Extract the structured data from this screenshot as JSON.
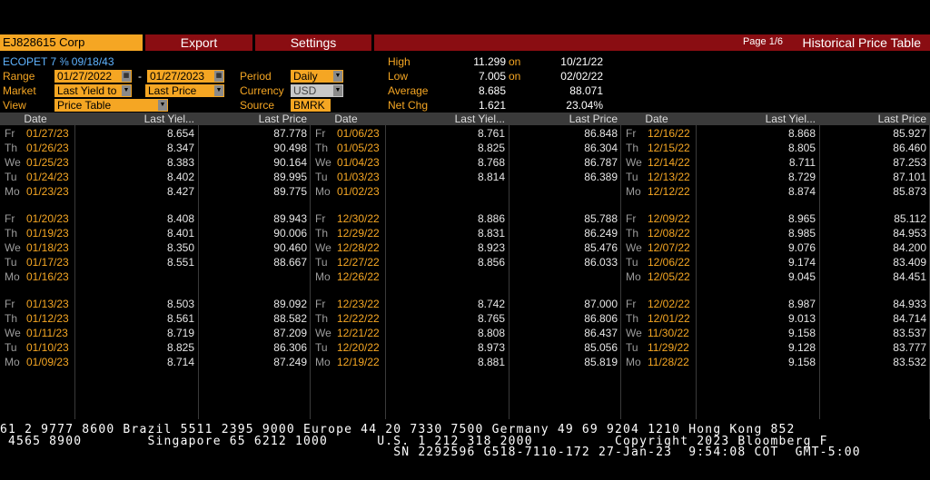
{
  "toolbar": {
    "security": "EJ828615 Corp",
    "export": "Export",
    "settings": "Settings",
    "page": "Page 1/6",
    "title": "Historical Price Table"
  },
  "bond": {
    "name": "ECOPET 7 ⅜ 09/18/43"
  },
  "controls": {
    "range_label": "Range",
    "range_start": "01/27/2022",
    "range_sep": "-",
    "range_end": "01/27/2023",
    "period_label": "Period",
    "period_value": "Daily",
    "market_label": "Market",
    "market_value1": "Last Yield to",
    "market_value2": "Last Price",
    "currency_label": "Currency",
    "currency_value": "USD",
    "view_label": "View",
    "view_value": "Price Table",
    "source_label": "Source",
    "source_value": "BMRK"
  },
  "stats": [
    {
      "label": "High",
      "value": "11.299",
      "on": "on",
      "date": "10/21/22"
    },
    {
      "label": "Low",
      "value": "7.005",
      "on": "on",
      "date": "02/02/22"
    },
    {
      "label": "Average",
      "value": "8.685",
      "on": "",
      "date": "88.071"
    },
    {
      "label": "Net Chg",
      "value": "1.621",
      "on": "",
      "date": "23.04%"
    }
  ],
  "columns": {
    "date": "Date",
    "yield": "Last Yiel...",
    "price": "Last Price"
  },
  "table": [
    [
      [
        "Fr",
        "01/27/23",
        "8.654",
        "87.778"
      ],
      [
        "Th",
        "01/26/23",
        "8.347",
        "90.498"
      ],
      [
        "We",
        "01/25/23",
        "8.383",
        "90.164"
      ],
      [
        "Tu",
        "01/24/23",
        "8.402",
        "89.995"
      ],
      [
        "Mo",
        "01/23/23",
        "8.427",
        "89.775"
      ],
      [
        "Fr",
        "01/20/23",
        "8.408",
        "89.943"
      ],
      [
        "Th",
        "01/19/23",
        "8.401",
        "90.006"
      ],
      [
        "We",
        "01/18/23",
        "8.350",
        "90.460"
      ],
      [
        "Tu",
        "01/17/23",
        "8.551",
        "88.667"
      ],
      [
        "Mo",
        "01/16/23",
        "",
        ""
      ],
      [
        "Fr",
        "01/13/23",
        "8.503",
        "89.092"
      ],
      [
        "Th",
        "01/12/23",
        "8.561",
        "88.582"
      ],
      [
        "We",
        "01/11/23",
        "8.719",
        "87.209"
      ],
      [
        "Tu",
        "01/10/23",
        "8.825",
        "86.306"
      ],
      [
        "Mo",
        "01/09/23",
        "8.714",
        "87.249"
      ]
    ],
    [
      [
        "Fr",
        "01/06/23",
        "8.761",
        "86.848"
      ],
      [
        "Th",
        "01/05/23",
        "8.825",
        "86.304"
      ],
      [
        "We",
        "01/04/23",
        "8.768",
        "86.787"
      ],
      [
        "Tu",
        "01/03/23",
        "8.814",
        "86.389"
      ],
      [
        "Mo",
        "01/02/23",
        "",
        ""
      ],
      [
        "Fr",
        "12/30/22",
        "8.886",
        "85.788"
      ],
      [
        "Th",
        "12/29/22",
        "8.831",
        "86.249"
      ],
      [
        "We",
        "12/28/22",
        "8.923",
        "85.476"
      ],
      [
        "Tu",
        "12/27/22",
        "8.856",
        "86.033"
      ],
      [
        "Mo",
        "12/26/22",
        "",
        ""
      ],
      [
        "Fr",
        "12/23/22",
        "8.742",
        "87.000"
      ],
      [
        "Th",
        "12/22/22",
        "8.765",
        "86.806"
      ],
      [
        "We",
        "12/21/22",
        "8.808",
        "86.437"
      ],
      [
        "Tu",
        "12/20/22",
        "8.973",
        "85.056"
      ],
      [
        "Mo",
        "12/19/22",
        "8.881",
        "85.819"
      ]
    ],
    [
      [
        "Fr",
        "12/16/22",
        "8.868",
        "85.927"
      ],
      [
        "Th",
        "12/15/22",
        "8.805",
        "86.460"
      ],
      [
        "We",
        "12/14/22",
        "8.711",
        "87.253"
      ],
      [
        "Tu",
        "12/13/22",
        "8.729",
        "87.101"
      ],
      [
        "Mo",
        "12/12/22",
        "8.874",
        "85.873"
      ],
      [
        "Fr",
        "12/09/22",
        "8.965",
        "85.112"
      ],
      [
        "Th",
        "12/08/22",
        "8.985",
        "84.953"
      ],
      [
        "We",
        "12/07/22",
        "9.076",
        "84.200"
      ],
      [
        "Tu",
        "12/06/22",
        "9.174",
        "83.409"
      ],
      [
        "Mo",
        "12/05/22",
        "9.045",
        "84.451"
      ],
      [
        "Fr",
        "12/02/22",
        "8.987",
        "84.933"
      ],
      [
        "Th",
        "12/01/22",
        "9.013",
        "84.714"
      ],
      [
        "We",
        "11/30/22",
        "9.158",
        "83.537"
      ],
      [
        "Tu",
        "11/29/22",
        "9.128",
        "83.777"
      ],
      [
        "Mo",
        "11/28/22",
        "9.158",
        "83.532"
      ]
    ]
  ],
  "footer": {
    "line1": "61 2 9777 8600 Brazil 5511 2395 9000 Europe 44 20 7330 7500 Germany 49 69 9204 1210 Hong Kong 852",
    "line2": " 4565 8900        Singapore 65 6212 1000      U.S. 1 212 318 2000          Copyright 2023 Bloomberg F",
    "line3": "                                                SN 2292596 G518-7110-172 27-Jan-23  9:54:08 COT  GMT-5:00"
  },
  "colors": {
    "accent": "#f5a623",
    "bar": "#8a0d12",
    "header": "#3a3a3a"
  }
}
